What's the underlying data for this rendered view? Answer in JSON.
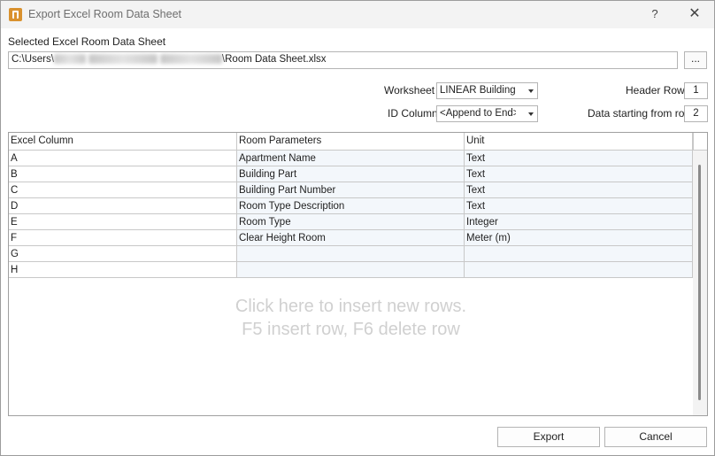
{
  "window": {
    "title": "Export Excel Room Data Sheet",
    "help_glyph": "?",
    "close_glyph": "✕"
  },
  "file": {
    "label": "Selected Excel Room Data Sheet",
    "path_prefix": "C:\\Users\\",
    "path_suffix": "\\Room Data Sheet.xlsx",
    "browse_label": "..."
  },
  "settings": {
    "worksheet_label": "Worksheet",
    "worksheet_value": "LINEAR Building Ex",
    "id_column_label": "ID Column",
    "id_column_value": "<Append to End>",
    "header_row_label": "Header Row",
    "header_row_value": "1",
    "data_start_label": "Data starting from row",
    "data_start_value": "2"
  },
  "grid": {
    "columns": [
      "Excel Column",
      "Room Parameters",
      "Unit"
    ],
    "rows": [
      {
        "col": "A",
        "param": "Apartment Name",
        "unit": "Text"
      },
      {
        "col": "B",
        "param": "Building Part",
        "unit": "Text"
      },
      {
        "col": "C",
        "param": "Building Part Number",
        "unit": "Text"
      },
      {
        "col": "D",
        "param": "Room Type Description",
        "unit": "Text"
      },
      {
        "col": "E",
        "param": "Room Type",
        "unit": "Integer"
      },
      {
        "col": "F",
        "param": "Clear Height Room",
        "unit": "Meter (m)"
      },
      {
        "col": "G",
        "param": "",
        "unit": ""
      },
      {
        "col": "H",
        "param": "",
        "unit": ""
      }
    ],
    "hint_line1": "Click here to insert new rows.",
    "hint_line2": "F5 insert row, F6 delete row"
  },
  "buttons": {
    "export": "Export",
    "cancel": "Cancel"
  },
  "colors": {
    "icon_accent": "#d9912e",
    "row_tint": "#f3f7fb"
  }
}
